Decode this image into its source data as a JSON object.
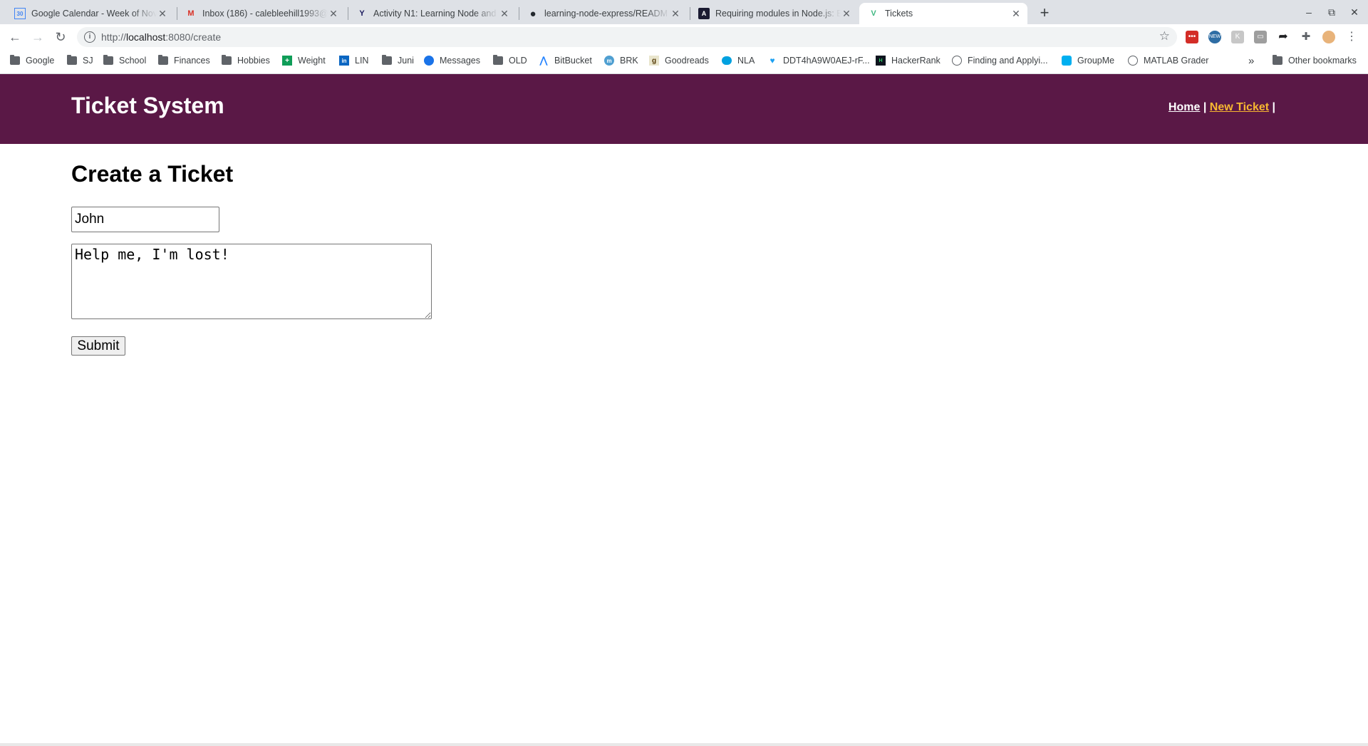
{
  "browser": {
    "tabs": [
      {
        "title": "Google Calendar - Week of Nov",
        "favicon": "calendar-icon",
        "favicon_text": "30"
      },
      {
        "title": "Inbox (186) - calebleehill1993@",
        "favicon": "gmail-icon",
        "favicon_text": "M"
      },
      {
        "title": "Activity N1: Learning Node and",
        "favicon": "y-icon",
        "favicon_text": "Y"
      },
      {
        "title": "learning-node-express/READM",
        "favicon": "github-icon",
        "favicon_text": "●"
      },
      {
        "title": "Requiring modules in Node.js: E",
        "favicon": "site-icon",
        "favicon_text": "A"
      },
      {
        "title": "Tickets",
        "favicon": "vue-icon",
        "favicon_text": "V"
      }
    ],
    "url": {
      "scheme": "http://",
      "host": "localhost",
      "path": ":8080/create"
    },
    "bookmarks": [
      {
        "label": "Google",
        "icon": "folder-icon"
      },
      {
        "label": "SJ",
        "icon": "folder-icon"
      },
      {
        "label": "School",
        "icon": "folder-icon"
      },
      {
        "label": "Finances",
        "icon": "folder-icon"
      },
      {
        "label": "Hobbies",
        "icon": "folder-icon"
      },
      {
        "label": "Weight",
        "icon": "sheets-icon"
      },
      {
        "label": "LIN",
        "icon": "linkedin-icon"
      },
      {
        "label": "Juni",
        "icon": "folder-icon"
      },
      {
        "label": "Messages",
        "icon": "messages-icon"
      },
      {
        "label": "OLD",
        "icon": "folder-icon"
      },
      {
        "label": "BitBucket",
        "icon": "bitbucket-icon"
      },
      {
        "label": "BRK",
        "icon": "brk-icon"
      },
      {
        "label": "Goodreads",
        "icon": "goodreads-icon"
      },
      {
        "label": "NLA",
        "icon": "salesforce-icon"
      },
      {
        "label": "DDT4hA9W0AEJ-rF...",
        "icon": "twitter-icon"
      },
      {
        "label": "HackerRank",
        "icon": "hackerrank-icon"
      },
      {
        "label": "Finding and Applyi...",
        "icon": "globe-icon"
      },
      {
        "label": "GroupMe",
        "icon": "groupme-icon"
      },
      {
        "label": "MATLAB Grader",
        "icon": "globe-icon"
      }
    ],
    "overflow_label": "»",
    "other_bookmarks": "Other bookmarks",
    "extensions": [
      "lastpass-icon",
      "new-extension-icon",
      "k-icon",
      "cast-icon",
      "share-icon",
      "puzzle-icon",
      "profile-avatar"
    ]
  },
  "page": {
    "site_title": "Ticket System",
    "nav": {
      "home": "Home",
      "separator": "|",
      "new_ticket": "New Ticket"
    },
    "heading": "Create a Ticket",
    "form": {
      "name_value": "John",
      "issue_value": "Help me, I'm lost!",
      "submit_label": "Submit"
    },
    "colors": {
      "header_bg": "#5a1846",
      "active_nav": "#f7b731"
    }
  }
}
